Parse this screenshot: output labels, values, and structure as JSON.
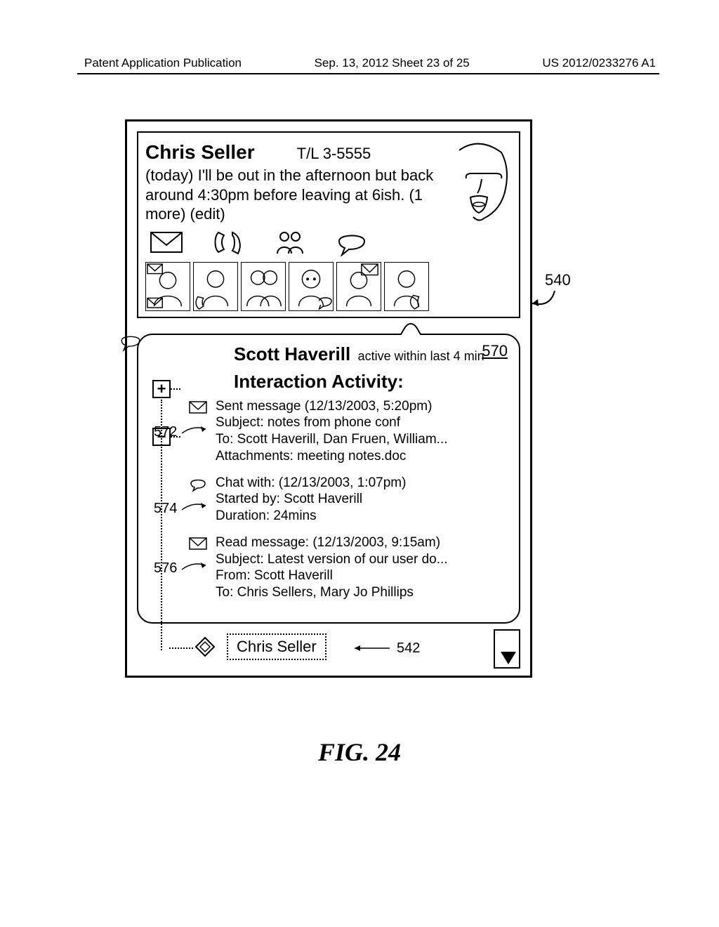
{
  "header": {
    "left": "Patent Application Publication",
    "center": "Sep. 13, 2012  Sheet 23 of 25",
    "right": "US 2012/0233276 A1"
  },
  "profile": {
    "name": "Chris Seller",
    "tl": "T/L 3-5555",
    "status": "(today) I'll be out in the afternoon but back around 4:30pm before leaving at 6ish.  (1 more)   (edit)"
  },
  "callout": {
    "ref": "570",
    "name": "Scott Haverill",
    "active": "active within last 4 min",
    "heading": "Interaction Activity:",
    "items": [
      {
        "icon": "mail",
        "ref": "572",
        "lines": [
          "Sent message (12/13/2003, 5:20pm)",
          "Subject: notes from phone conf",
          "To: Scott Haverill, Dan Fruen, William...",
          "Attachments: meeting notes.doc"
        ]
      },
      {
        "icon": "chat",
        "ref": "574",
        "lines": [
          "Chat with: (12/13/2003, 1:07pm)",
          "Started by: Scott Haverill",
          "Duration: 24mins"
        ]
      },
      {
        "icon": "mail",
        "ref": "576",
        "lines": [
          "Read message: (12/13/2003, 9:15am)",
          "Subject: Latest version of our user do...",
          "From: Scott Haverill",
          "To: Chris Sellers, Mary Jo Phillips"
        ]
      }
    ]
  },
  "bottom": {
    "name": "Chris Seller",
    "ref": "542"
  },
  "label540": "540",
  "caption": "FIG. 24"
}
